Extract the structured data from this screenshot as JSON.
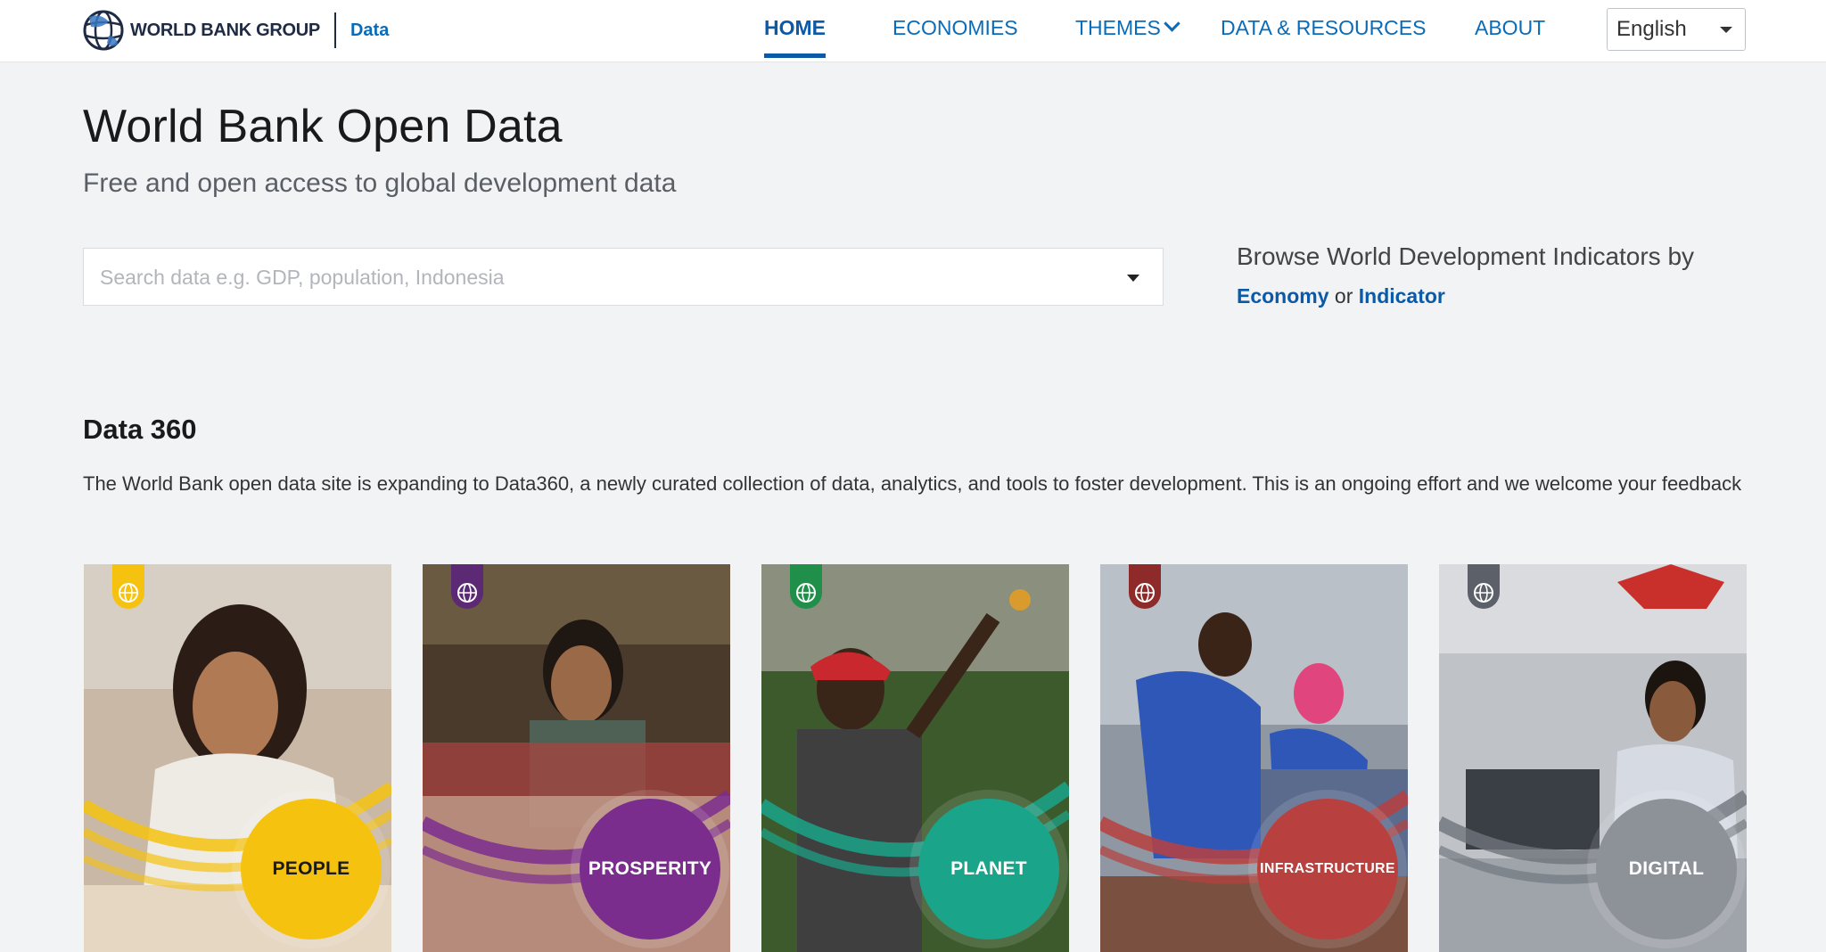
{
  "header": {
    "brand": "WORLD BANK GROUP",
    "section_link": "Data",
    "nav": [
      {
        "label": "HOME",
        "active": true
      },
      {
        "label": "ECONOMIES",
        "active": false
      },
      {
        "label": "THEMES",
        "active": false,
        "has_dropdown": true
      },
      {
        "label": "DATA & RESOURCES",
        "active": false
      },
      {
        "label": "ABOUT",
        "active": false
      }
    ],
    "language": {
      "selected": "English"
    }
  },
  "hero": {
    "title": "World Bank Open Data",
    "subtitle": "Free and open access to global development data",
    "search": {
      "placeholder": "Search data e.g. GDP, population, Indonesia",
      "value": ""
    },
    "browse": {
      "text": "Browse World Development Indicators by",
      "link_economy": "Economy",
      "connector": "or",
      "link_indicator": "Indicator"
    }
  },
  "data360": {
    "title": "Data 360",
    "description": "The World Bank open data site is expanding to Data360, a newly curated collection of data, analytics, and tools to foster development. This is an ongoing effort and we welcome your feedback",
    "cards": [
      {
        "label": "PEOPLE",
        "accent": "#f5c20f",
        "label_color": "#1a1a1a",
        "tab_color": "#f5c20f",
        "icon": "globe-icon"
      },
      {
        "label": "PROSPERITY",
        "accent": "#7b2d8e",
        "label_color": "#ffffff",
        "tab_color": "#5c2a74",
        "icon": "globe-icon"
      },
      {
        "label": "PLANET",
        "accent": "#1aa58a",
        "label_color": "#ffffff",
        "tab_color": "#1f8f4a",
        "icon": "globe-icon"
      },
      {
        "label": "INFRASTRUCTURE",
        "accent": "#b8403f",
        "label_color": "#ffffff",
        "tab_color": "#8e2a2a",
        "icon": "globe-icon"
      },
      {
        "label": "DIGITAL",
        "accent": "#8d9198",
        "label_color": "#ffffff",
        "tab_color": "#5c6068",
        "icon": "globe-icon"
      }
    ]
  },
  "colors": {
    "link_blue": "#0a6cb8",
    "active_blue": "#0a5aa8",
    "page_bg": "#f2f3f5"
  }
}
